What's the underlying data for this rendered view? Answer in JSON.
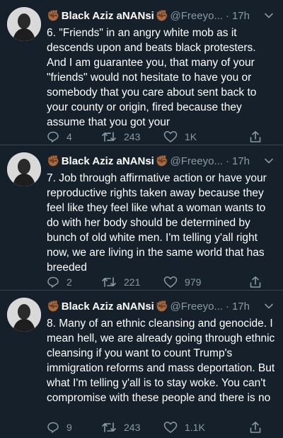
{
  "tweets": [
    {
      "author": "Black Aziz aNANsi",
      "handle": "@Freeyo...",
      "time": "17h",
      "text": "6. \"Friends\" in an angry white mob as it descends upon and beats black protesters. And I am guarantee you, that many of your \"friends\" would not hesitate to have you or somebody that you care about sent back to your county or origin, fired because they assume that you got your",
      "replies": "4",
      "retweets": "243",
      "likes": "1K"
    },
    {
      "author": "Black Aziz aNANsi",
      "handle": "@Freeyo...",
      "time": "17h",
      "text": "7. Job through affirmative action or have your reproductive rights taken away because they feel like they feel like what a woman wants to do with her body should be determined by bunch of old white men. I'm telling y'all right now, we are living in the same world that has breeded",
      "replies": "2",
      "retweets": "221",
      "likes": "979"
    },
    {
      "author": "Black Aziz aNANsi",
      "handle": "@Freeyo...",
      "time": "17h",
      "text": "8. Many of an ethnic cleansing and genocide. I mean hell, we are already going through ethnic cleansing if you want to count Trump's immigration reforms and mass deportation. But what I'm telling y'all is to stay woke. You can't compromise with these people and there is no",
      "replies": "9",
      "retweets": "243",
      "likes": "1.1K"
    }
  ],
  "icons": {
    "name_decoration": "raised-fist-emoji",
    "reply": "reply-icon",
    "retweet": "retweet-icon",
    "like": "like-icon",
    "share": "share-icon",
    "menu": "chevron-down-icon"
  },
  "colors": {
    "background": "#15202b",
    "secondary_text": "#8899a6",
    "divider": "#38444d"
  }
}
